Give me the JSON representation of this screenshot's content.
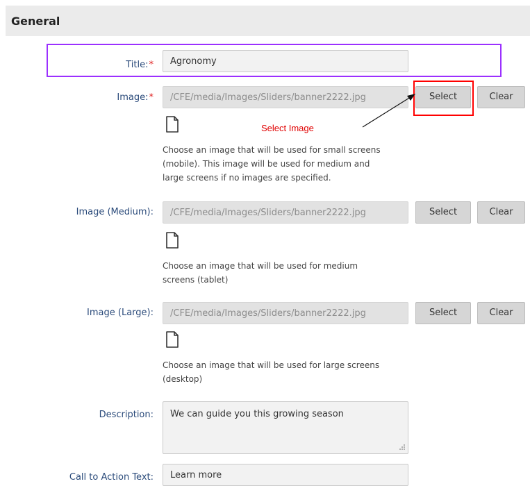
{
  "section": {
    "title": "General"
  },
  "title_field": {
    "label": "Title:",
    "required_mark": "*",
    "value": "Agronomy"
  },
  "image": {
    "label": "Image:",
    "required_mark": "*",
    "value": "/CFE/media/Images/Sliders/banner2222.jpg",
    "select_label": "Select",
    "clear_label": "Clear",
    "help": "Choose an image that will be used for small screens (mobile). This image will be used for medium and large screens if no images are specified."
  },
  "image_medium": {
    "label": "Image (Medium):",
    "value": "/CFE/media/Images/Sliders/banner2222.jpg",
    "select_label": "Select",
    "clear_label": "Clear",
    "help": "Choose an image that will be used for medium screens (tablet)"
  },
  "image_large": {
    "label": "Image (Large):",
    "value": "/CFE/media/Images/Sliders/banner2222.jpg",
    "select_label": "Select",
    "clear_label": "Clear",
    "help": "Choose an image that will be used for large screens (desktop)"
  },
  "description": {
    "label": "Description:",
    "value": "We can guide you this growing season"
  },
  "cta": {
    "label": "Call to Action Text:",
    "value": "Learn more"
  },
  "annotation": {
    "text": "Select Image"
  },
  "icons": {
    "file": "file-icon",
    "resize": "resize-grip-icon",
    "arrow": "arrow-icon"
  },
  "colors": {
    "header_bg": "#ebebeb",
    "label_color": "#2a4a7a",
    "required_color": "#e02020",
    "highlight_title": "#9b30ff",
    "highlight_select": "#ff0000"
  }
}
